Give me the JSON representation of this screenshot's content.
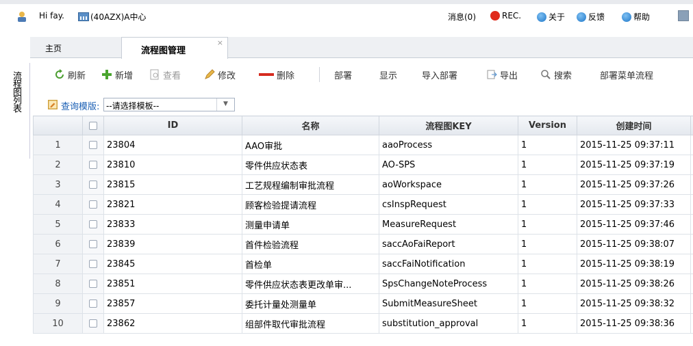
{
  "header": {
    "greeting": "Hi fay.",
    "org": "(40AZX)A中心",
    "messages": "消息(0)",
    "rec": "REC.",
    "about": "关于",
    "feedback": "反馈",
    "help": "帮助"
  },
  "tabs": [
    {
      "label": "主页"
    },
    {
      "label": "流程图管理",
      "close": "×"
    }
  ],
  "side_panel": {
    "label": "流程图列表"
  },
  "toolbar": {
    "refresh": "刷新",
    "add": "新增",
    "view": "查看",
    "edit": "修改",
    "delete": "删除",
    "deploy": "部署",
    "show": "显示",
    "import_deploy": "导入部署",
    "export": "导出",
    "search": "搜索",
    "deploy_menu": "部署菜单流程"
  },
  "query": {
    "label": "查询模版:",
    "select_value": "--请选择模板--",
    "arrow": "▼"
  },
  "table": {
    "headers": [
      "ID",
      "名称",
      "流程图KEY",
      "Version",
      "创建时间"
    ],
    "rows": [
      {
        "num": "1",
        "id": "23804",
        "name": "AAO审批",
        "key": "aaoProcess",
        "version": "1",
        "created": "2015-11-25 09:37:11"
      },
      {
        "num": "2",
        "id": "23810",
        "name": "零件供应状态表",
        "key": "AO-SPS",
        "version": "1",
        "created": "2015-11-25 09:37:19"
      },
      {
        "num": "3",
        "id": "23815",
        "name": "工艺规程编制审批流程",
        "key": "aoWorkspace",
        "version": "1",
        "created": "2015-11-25 09:37:26"
      },
      {
        "num": "4",
        "id": "23821",
        "name": "顾客检验提请流程",
        "key": "csInspRequest",
        "version": "1",
        "created": "2015-11-25 09:37:33"
      },
      {
        "num": "5",
        "id": "23833",
        "name": "测量申请单",
        "key": "MeasureRequest",
        "version": "1",
        "created": "2015-11-25 09:37:46"
      },
      {
        "num": "6",
        "id": "23839",
        "name": "首件检验流程",
        "key": "saccAoFaiReport",
        "version": "1",
        "created": "2015-11-25 09:38:07"
      },
      {
        "num": "7",
        "id": "23845",
        "name": "首检单",
        "key": "saccFaiNotification",
        "version": "1",
        "created": "2015-11-25 09:38:19"
      },
      {
        "num": "8",
        "id": "23851",
        "name": "零件供应状态表更改单审...",
        "key": "SpsChangeNoteProcess",
        "version": "1",
        "created": "2015-11-25 09:38:26"
      },
      {
        "num": "9",
        "id": "23857",
        "name": "委托计量处测量单",
        "key": "SubmitMeasureSheet",
        "version": "1",
        "created": "2015-11-25 09:38:32"
      },
      {
        "num": "10",
        "id": "23862",
        "name": "组部件取代审批流程",
        "key": "substitution_approval",
        "version": "1",
        "created": "2015-11-25 09:38:36"
      }
    ]
  },
  "colors": {
    "accent_blue": "#1a5fb4",
    "rec_red": "#e02a1a",
    "header_bg": "#eef0f3"
  }
}
